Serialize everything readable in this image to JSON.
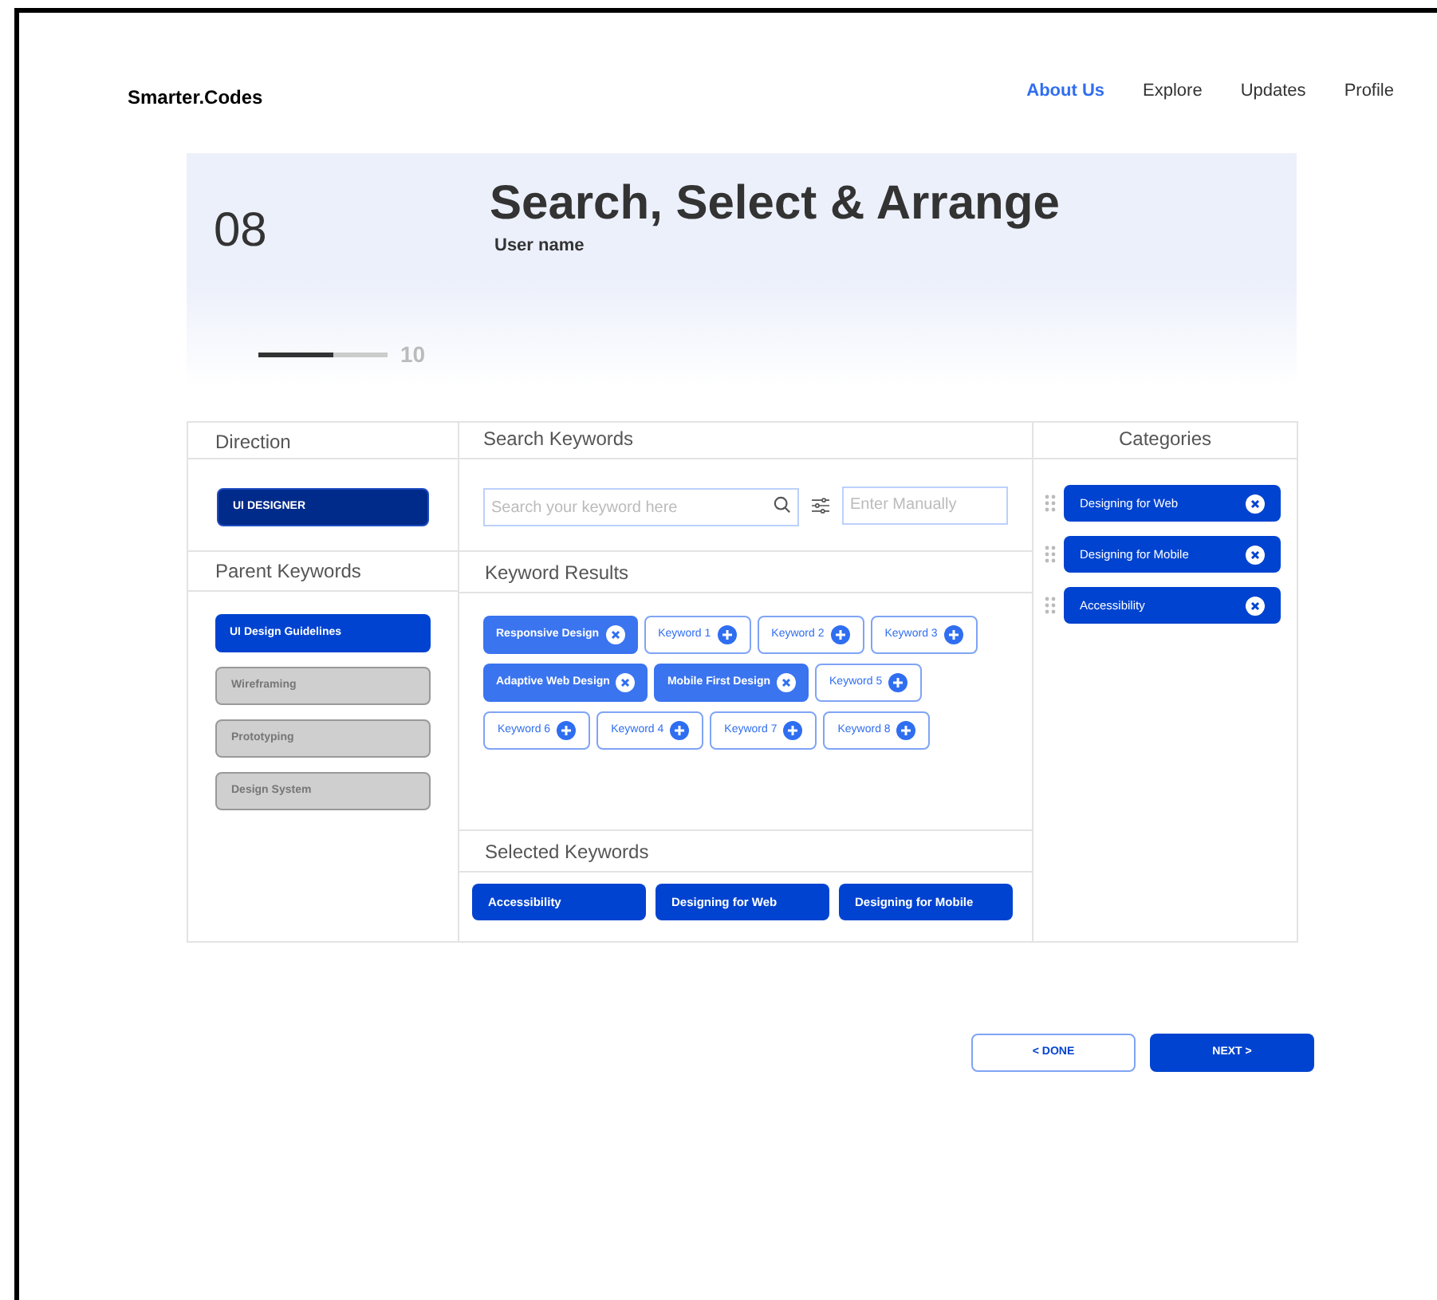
{
  "nav": {
    "logo": "Smarter.Codes",
    "links": [
      {
        "label": "About Us",
        "selected": true
      },
      {
        "label": "Explore",
        "selected": false
      },
      {
        "label": "Updates",
        "selected": false
      },
      {
        "label": "Profile",
        "selected": false
      }
    ]
  },
  "hero": {
    "step": "08",
    "title": "Search, Select & Arrange",
    "subtitle": "User name",
    "progress": {
      "level": 0.58,
      "total": "10"
    }
  },
  "direction": {
    "heading": "Direction",
    "value": "UI DESIGNER"
  },
  "parent_keywords": {
    "heading": "Parent Keywords",
    "items": [
      {
        "label": "UI Design Guidelines",
        "selected": true
      },
      {
        "label": "Wireframing",
        "selected": false
      },
      {
        "label": "Prototyping",
        "selected": false
      },
      {
        "label": "Design System",
        "selected": false
      }
    ]
  },
  "search": {
    "heading": "Search Keywords",
    "placeholder": "Search your keyword here",
    "manual_placeholder": "Enter Manually"
  },
  "keyword_results": {
    "heading": "Keyword Results",
    "rows": [
      [
        {
          "label": "Responsive Design",
          "selected": true
        },
        {
          "label": "Keyword 1",
          "selected": false
        },
        {
          "label": "Keyword 2",
          "selected": false
        },
        {
          "label": "Keyword 3",
          "selected": false
        }
      ],
      [
        {
          "label": "Adaptive Web Design",
          "selected": true
        },
        {
          "label": "Mobile First Design",
          "selected": true
        },
        {
          "label": "Keyword 5",
          "selected": false
        }
      ],
      [
        {
          "label": "Keyword 6",
          "selected": false
        },
        {
          "label": "Keyword 4",
          "selected": false
        },
        {
          "label": "Keyword 7",
          "selected": false
        },
        {
          "label": "Keyword 8",
          "selected": false
        }
      ]
    ]
  },
  "selected_keywords": {
    "heading": "Selected Keywords",
    "items": [
      "Accessibility",
      "Designing for Web",
      "Designing for Mobile"
    ]
  },
  "categories": {
    "heading": "Categories",
    "items": [
      "Designing for Web",
      "Designing for Mobile",
      "Accessibility"
    ]
  },
  "buttons": [
    {
      "label": "< DONE",
      "kind": "outline"
    },
    {
      "label": "NEXT >",
      "kind": "primary"
    }
  ]
}
